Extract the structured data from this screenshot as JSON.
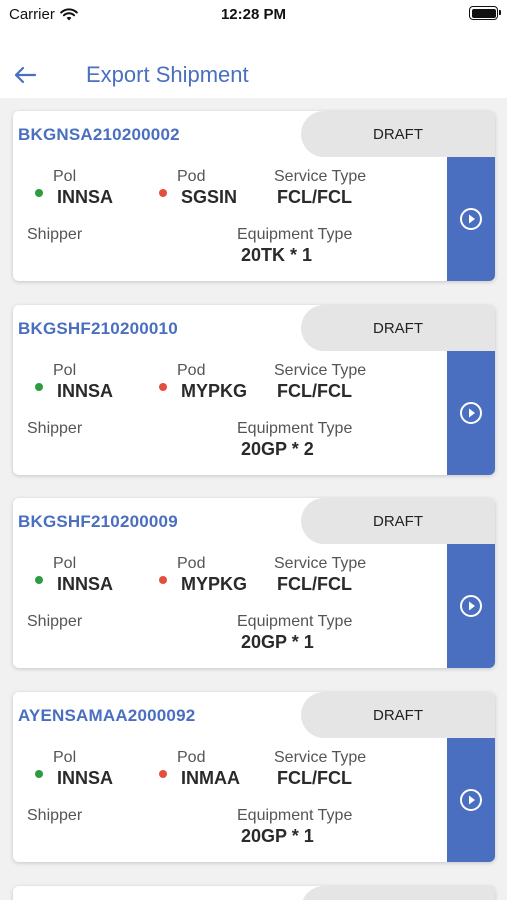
{
  "status_bar": {
    "carrier": "Carrier",
    "time": "12:28 PM"
  },
  "header": {
    "title": "Export Shipment"
  },
  "labels": {
    "pol": "Pol",
    "pod": "Pod",
    "service_type": "Service Type",
    "shipper": "Shipper",
    "equipment_type": "Equipment Type"
  },
  "shipments": [
    {
      "booking_no": "BKGNSA210200002",
      "status": "DRAFT",
      "pol": "INNSA",
      "pod": "SGSIN",
      "service_type": "FCL/FCL",
      "shipper": "",
      "equipment_type": "20TK * 1"
    },
    {
      "booking_no": "BKGSHF210200010",
      "status": "DRAFT",
      "pol": "INNSA",
      "pod": "MYPKG",
      "service_type": "FCL/FCL",
      "shipper": "",
      "equipment_type": "20GP * 2"
    },
    {
      "booking_no": "BKGSHF210200009",
      "status": "DRAFT",
      "pol": "INNSA",
      "pod": "MYPKG",
      "service_type": "FCL/FCL",
      "shipper": "",
      "equipment_type": "20GP * 1"
    },
    {
      "booking_no": "AYENSAMAA2000092",
      "status": "DRAFT",
      "pol": "INNSA",
      "pod": "INMAA",
      "service_type": "FCL/FCL",
      "shipper": "",
      "equipment_type": "20GP * 1"
    }
  ],
  "colors": {
    "accent": "#4a6fc0",
    "pol_dot": "#2e9b3e",
    "pod_dot": "#e2503c",
    "pill": "#e5e5e5"
  }
}
